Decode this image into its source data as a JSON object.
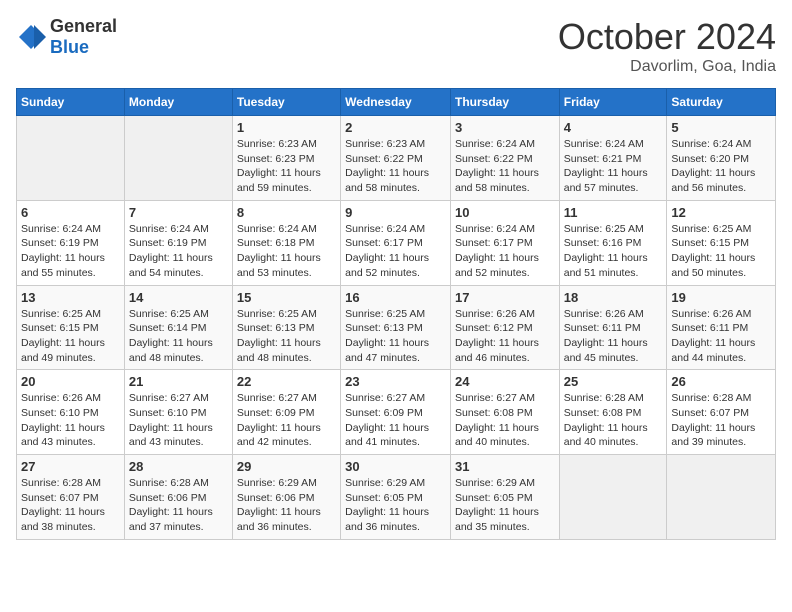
{
  "header": {
    "logo_general": "General",
    "logo_blue": "Blue",
    "month_title": "October 2024",
    "location": "Davorlim, Goa, India"
  },
  "weekdays": [
    "Sunday",
    "Monday",
    "Tuesday",
    "Wednesday",
    "Thursday",
    "Friday",
    "Saturday"
  ],
  "weeks": [
    [
      {
        "day": "",
        "empty": true
      },
      {
        "day": "",
        "empty": true
      },
      {
        "day": "1",
        "sunrise": "6:23 AM",
        "sunset": "6:23 PM",
        "daylight": "11 hours and 59 minutes."
      },
      {
        "day": "2",
        "sunrise": "6:23 AM",
        "sunset": "6:22 PM",
        "daylight": "11 hours and 58 minutes."
      },
      {
        "day": "3",
        "sunrise": "6:24 AM",
        "sunset": "6:22 PM",
        "daylight": "11 hours and 58 minutes."
      },
      {
        "day": "4",
        "sunrise": "6:24 AM",
        "sunset": "6:21 PM",
        "daylight": "11 hours and 57 minutes."
      },
      {
        "day": "5",
        "sunrise": "6:24 AM",
        "sunset": "6:20 PM",
        "daylight": "11 hours and 56 minutes."
      }
    ],
    [
      {
        "day": "6",
        "sunrise": "6:24 AM",
        "sunset": "6:19 PM",
        "daylight": "11 hours and 55 minutes."
      },
      {
        "day": "7",
        "sunrise": "6:24 AM",
        "sunset": "6:19 PM",
        "daylight": "11 hours and 54 minutes."
      },
      {
        "day": "8",
        "sunrise": "6:24 AM",
        "sunset": "6:18 PM",
        "daylight": "11 hours and 53 minutes."
      },
      {
        "day": "9",
        "sunrise": "6:24 AM",
        "sunset": "6:17 PM",
        "daylight": "11 hours and 52 minutes."
      },
      {
        "day": "10",
        "sunrise": "6:24 AM",
        "sunset": "6:17 PM",
        "daylight": "11 hours and 52 minutes."
      },
      {
        "day": "11",
        "sunrise": "6:25 AM",
        "sunset": "6:16 PM",
        "daylight": "11 hours and 51 minutes."
      },
      {
        "day": "12",
        "sunrise": "6:25 AM",
        "sunset": "6:15 PM",
        "daylight": "11 hours and 50 minutes."
      }
    ],
    [
      {
        "day": "13",
        "sunrise": "6:25 AM",
        "sunset": "6:15 PM",
        "daylight": "11 hours and 49 minutes."
      },
      {
        "day": "14",
        "sunrise": "6:25 AM",
        "sunset": "6:14 PM",
        "daylight": "11 hours and 48 minutes."
      },
      {
        "day": "15",
        "sunrise": "6:25 AM",
        "sunset": "6:13 PM",
        "daylight": "11 hours and 48 minutes."
      },
      {
        "day": "16",
        "sunrise": "6:25 AM",
        "sunset": "6:13 PM",
        "daylight": "11 hours and 47 minutes."
      },
      {
        "day": "17",
        "sunrise": "6:26 AM",
        "sunset": "6:12 PM",
        "daylight": "11 hours and 46 minutes."
      },
      {
        "day": "18",
        "sunrise": "6:26 AM",
        "sunset": "6:11 PM",
        "daylight": "11 hours and 45 minutes."
      },
      {
        "day": "19",
        "sunrise": "6:26 AM",
        "sunset": "6:11 PM",
        "daylight": "11 hours and 44 minutes."
      }
    ],
    [
      {
        "day": "20",
        "sunrise": "6:26 AM",
        "sunset": "6:10 PM",
        "daylight": "11 hours and 43 minutes."
      },
      {
        "day": "21",
        "sunrise": "6:27 AM",
        "sunset": "6:10 PM",
        "daylight": "11 hours and 43 minutes."
      },
      {
        "day": "22",
        "sunrise": "6:27 AM",
        "sunset": "6:09 PM",
        "daylight": "11 hours and 42 minutes."
      },
      {
        "day": "23",
        "sunrise": "6:27 AM",
        "sunset": "6:09 PM",
        "daylight": "11 hours and 41 minutes."
      },
      {
        "day": "24",
        "sunrise": "6:27 AM",
        "sunset": "6:08 PM",
        "daylight": "11 hours and 40 minutes."
      },
      {
        "day": "25",
        "sunrise": "6:28 AM",
        "sunset": "6:08 PM",
        "daylight": "11 hours and 40 minutes."
      },
      {
        "day": "26",
        "sunrise": "6:28 AM",
        "sunset": "6:07 PM",
        "daylight": "11 hours and 39 minutes."
      }
    ],
    [
      {
        "day": "27",
        "sunrise": "6:28 AM",
        "sunset": "6:07 PM",
        "daylight": "11 hours and 38 minutes."
      },
      {
        "day": "28",
        "sunrise": "6:28 AM",
        "sunset": "6:06 PM",
        "daylight": "11 hours and 37 minutes."
      },
      {
        "day": "29",
        "sunrise": "6:29 AM",
        "sunset": "6:06 PM",
        "daylight": "11 hours and 36 minutes."
      },
      {
        "day": "30",
        "sunrise": "6:29 AM",
        "sunset": "6:05 PM",
        "daylight": "11 hours and 36 minutes."
      },
      {
        "day": "31",
        "sunrise": "6:29 AM",
        "sunset": "6:05 PM",
        "daylight": "11 hours and 35 minutes."
      },
      {
        "day": "",
        "empty": true
      },
      {
        "day": "",
        "empty": true
      }
    ]
  ],
  "labels": {
    "sunrise": "Sunrise:",
    "sunset": "Sunset:",
    "daylight": "Daylight:"
  }
}
